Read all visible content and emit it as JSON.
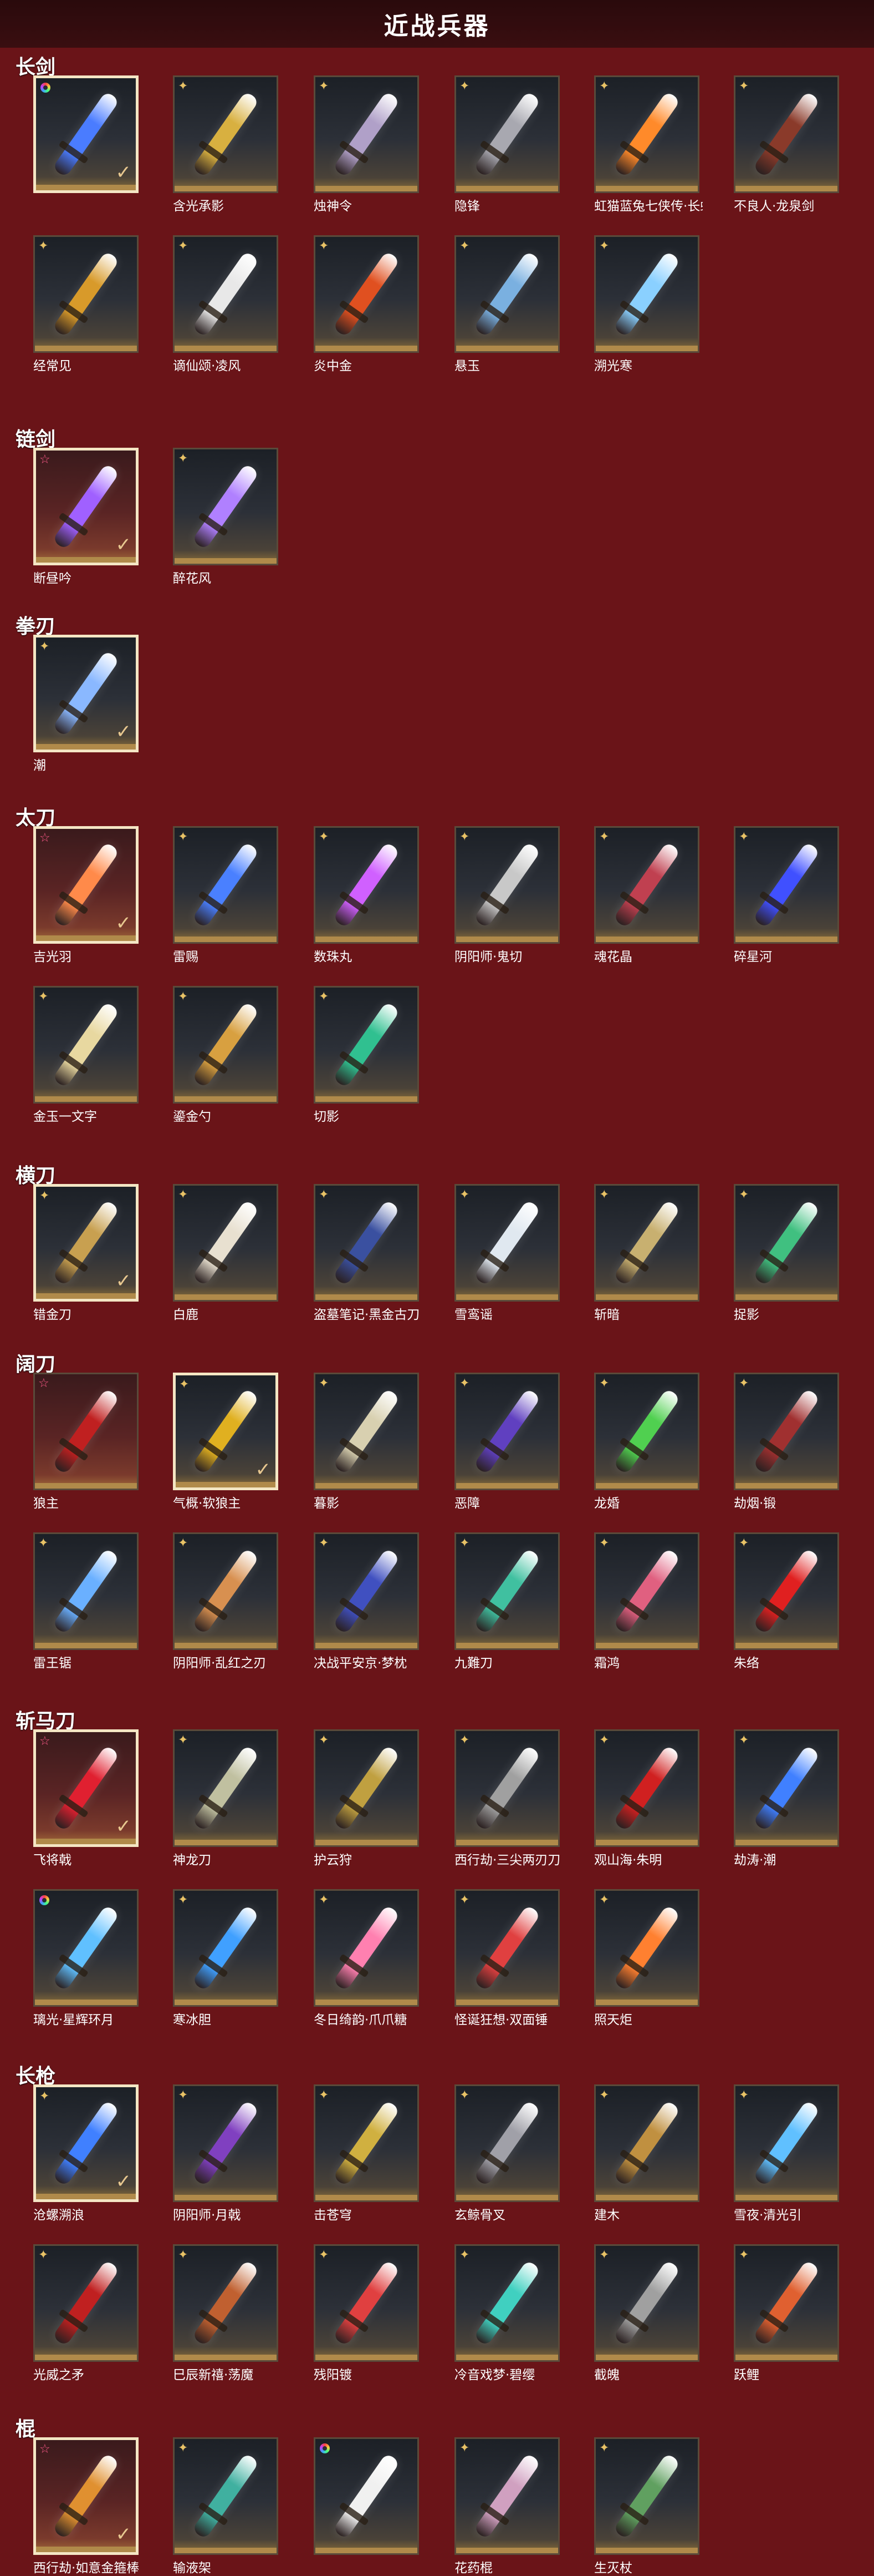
{
  "page_title": "近战兵器",
  "sections": [
    {
      "title": "长剑",
      "items": [
        {
          "name": "",
          "badge": "ring",
          "equipped": true,
          "color": "#4a7cff"
        },
        {
          "name": "含光承影",
          "badge": "gold",
          "color": "#d8b040"
        },
        {
          "name": "烛神令",
          "badge": "gold",
          "color": "#b0a0c8"
        },
        {
          "name": "隐锋",
          "badge": "gold",
          "color": "#a8a8b0"
        },
        {
          "name": "虹猫蓝兔七侠传·长虹剑",
          "badge": "gold",
          "color": "#ff8a2a"
        },
        {
          "name": "不良人·龙泉剑",
          "badge": "gold",
          "color": "#8a3a2a"
        },
        {
          "name": "经常见",
          "badge": "gold",
          "color": "#d89a2a"
        },
        {
          "name": "谪仙颂·凌风",
          "badge": "gold",
          "color": "#e8e8e8"
        },
        {
          "name": "炎中金",
          "badge": "gold",
          "color": "#e05020"
        },
        {
          "name": "悬玉",
          "badge": "gold",
          "color": "#7ab0e0"
        },
        {
          "name": "溯光寒",
          "badge": "gold",
          "color": "#8ad0ff"
        }
      ]
    },
    {
      "title": "链剑",
      "items": [
        {
          "name": "断昼吟",
          "badge": "pink",
          "equipped": true,
          "color": "#a060ff",
          "red": true
        },
        {
          "name": "醉花风",
          "badge": "gold",
          "color": "#b080ff"
        }
      ]
    },
    {
      "title": "拳刃",
      "items": [
        {
          "name": "潮",
          "badge": "gold",
          "equipped": true,
          "color": "#8ab8ff"
        }
      ]
    },
    {
      "title": "太刀",
      "items": [
        {
          "name": "吉光羽",
          "badge": "pink",
          "equipped": true,
          "color": "#ff8a4a",
          "red": true
        },
        {
          "name": "雷赐",
          "badge": "gold",
          "color": "#4a80ff"
        },
        {
          "name": "数珠丸",
          "badge": "gold",
          "color": "#d060ff"
        },
        {
          "name": "阴阳师·鬼切",
          "badge": "gold",
          "color": "#c8c8c8"
        },
        {
          "name": "魂花晶",
          "badge": "gold",
          "color": "#c04050"
        },
        {
          "name": "碎星河",
          "badge": "gold",
          "color": "#4050ff"
        },
        {
          "name": "金玉一文字",
          "badge": "gold",
          "color": "#e8d8a0"
        },
        {
          "name": "鎏金勺",
          "badge": "gold",
          "color": "#d8a040"
        },
        {
          "name": "切影",
          "badge": "gold",
          "color": "#30c090"
        }
      ]
    },
    {
      "title": "横刀",
      "items": [
        {
          "name": "错金刀",
          "badge": "gold",
          "equipped": true,
          "color": "#c8a050"
        },
        {
          "name": "白鹿",
          "badge": "gold",
          "color": "#e8e0d0"
        },
        {
          "name": "盗墓笔记·黑金古刀",
          "badge": "gold",
          "color": "#3a50a0"
        },
        {
          "name": "雪鸾谣",
          "badge": "gold",
          "color": "#e0e8f0"
        },
        {
          "name": "斩暗",
          "badge": "gold",
          "color": "#c8b070"
        },
        {
          "name": "捉影",
          "badge": "gold",
          "color": "#40c080"
        }
      ]
    },
    {
      "title": "阔刀",
      "items": [
        {
          "name": "狼主",
          "badge": "pink",
          "color": "#c02020",
          "red": true
        },
        {
          "name": "气概·软狼主",
          "badge": "gold",
          "equipped": true,
          "color": "#e0b020"
        },
        {
          "name": "暮影",
          "badge": "gold",
          "color": "#d8d0b0"
        },
        {
          "name": "恶障",
          "badge": "gold",
          "color": "#6040c0"
        },
        {
          "name": "龙婚",
          "badge": "gold",
          "color": "#50d050"
        },
        {
          "name": "劫烟·锻",
          "badge": "gold",
          "color": "#a03030"
        },
        {
          "name": "雷王锯",
          "badge": "gold",
          "color": "#6ab0ff"
        },
        {
          "name": "阴阳师·乱红之刃",
          "badge": "gold",
          "color": "#d89050"
        },
        {
          "name": "决战平安京·梦枕",
          "badge": "gold",
          "color": "#4050c0"
        },
        {
          "name": "九難刀",
          "badge": "gold",
          "color": "#40c0a0"
        },
        {
          "name": "霜鸿",
          "badge": "gold",
          "color": "#e06080"
        },
        {
          "name": "朱络",
          "badge": "gold",
          "color": "#e02020"
        }
      ]
    },
    {
      "title": "斩马刀",
      "items": [
        {
          "name": "飞将戟",
          "badge": "pink",
          "equipped": true,
          "color": "#e02030",
          "red": true
        },
        {
          "name": "神龙刀",
          "badge": "gold",
          "color": "#c0c0a0"
        },
        {
          "name": "护云狩",
          "badge": "gold",
          "color": "#c0a040"
        },
        {
          "name": "西行劫·三尖两刃刀",
          "badge": "gold",
          "color": "#a0a0a0"
        },
        {
          "name": "观山海·朱明",
          "badge": "gold",
          "color": "#d02020"
        },
        {
          "name": "劫涛·潮",
          "badge": "gold",
          "color": "#4080ff"
        },
        {
          "name": "璃光·星辉环月",
          "badge": "ring",
          "color": "#60c0ff"
        },
        {
          "name": "寒冰胆",
          "badge": "gold",
          "color": "#40a0ff"
        },
        {
          "name": "冬日绮韵·爪爪糖",
          "badge": "gold",
          "color": "#ff80b0"
        },
        {
          "name": "怪诞狂想·双面锤",
          "badge": "gold",
          "color": "#e04040"
        },
        {
          "name": "照天炬",
          "badge": "gold",
          "color": "#ff8030"
        }
      ]
    },
    {
      "title": "长枪",
      "items": [
        {
          "name": "沧螺溯浪",
          "badge": "gold",
          "equipped": true,
          "color": "#4080ff"
        },
        {
          "name": "阴阳师·月戟",
          "badge": "gold",
          "color": "#8040c0"
        },
        {
          "name": "击苍穹",
          "badge": "gold",
          "color": "#d0b040"
        },
        {
          "name": "玄鲸骨叉",
          "badge": "gold",
          "color": "#a0a0a8"
        },
        {
          "name": "建木",
          "badge": "gold",
          "color": "#c09040"
        },
        {
          "name": "雪夜·清光引",
          "badge": "gold",
          "color": "#60c0ff"
        },
        {
          "name": "光威之矛",
          "badge": "gold",
          "color": "#c02020"
        },
        {
          "name": "巳辰新禧·荡魔",
          "badge": "gold",
          "color": "#c06030"
        },
        {
          "name": "残阳镀",
          "badge": "gold",
          "color": "#e04040"
        },
        {
          "name": "冷音戏梦·碧缨",
          "badge": "gold",
          "color": "#40d0c0"
        },
        {
          "name": "截魄",
          "badge": "gold",
          "color": "#a0a0a0"
        },
        {
          "name": "跃鲤",
          "badge": "gold",
          "color": "#e06030"
        }
      ]
    },
    {
      "title": "棍",
      "items": [
        {
          "name": "西行劫·如意金箍棒",
          "badge": "pink",
          "equipped": true,
          "color": "#e09030",
          "red": true
        },
        {
          "name": "输液架",
          "badge": "gold",
          "color": "#40b0a0"
        },
        {
          "name": "",
          "badge": "ring",
          "color": "#f0f0f0"
        },
        {
          "name": "花药棍",
          "badge": "gold",
          "color": "#d0a0c0"
        },
        {
          "name": "生灭杖",
          "badge": "gold",
          "color": "#60a060"
        }
      ]
    }
  ]
}
